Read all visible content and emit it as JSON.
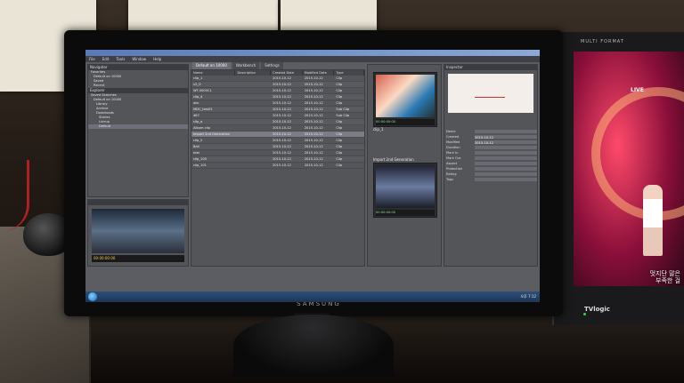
{
  "scene": {
    "monitor_brand": "SAMSUNG",
    "right_monitor_header": "MULTI FORMAT",
    "right_monitor_brand": "TVlogic",
    "right_monitor_show_logo": "LIVE",
    "right_monitor_caption_line1": "멋지단 말은",
    "right_monitor_caption_line2": "부족한 걸"
  },
  "app": {
    "menu": [
      "File",
      "Edit",
      "Tools",
      "Window",
      "Help"
    ],
    "tabs": [
      "Default on 10000",
      "Workbench",
      "Settings"
    ],
    "navigator_title": "Navigator",
    "explorer_title": "Explorer",
    "inspector_title": "Inspector",
    "tree": [
      "Favorites",
      "Default on 10000",
      "Saved",
      "Recent",
      "Explorer",
      "Saved Searches",
      "Default on 10000",
      "Library",
      "Archive",
      "Downloads",
      "Stories",
      "Lineup",
      "Default"
    ],
    "columns": [
      "Name",
      "Description",
      "Created Date",
      "Modified Date",
      "Type"
    ],
    "rows": [
      [
        "clip_1",
        "",
        "2015-10-12",
        "2015-10-12",
        "Clip"
      ],
      [
        "v2_0",
        "",
        "2015-10-12",
        "2015-10-12",
        "Clip"
      ],
      [
        "WT-0000C1",
        "",
        "2015-10-12",
        "2015-10-12",
        "Clip"
      ],
      [
        "clip_4",
        "",
        "2015-10-12",
        "2015-10-12",
        "Clip"
      ],
      [
        "abc",
        "",
        "2015-10-12",
        "2015-10-12",
        "Clip"
      ],
      [
        "MDC_test01",
        "",
        "2015-10-12",
        "2015-10-12",
        "Sub Clip"
      ],
      [
        "487",
        "",
        "2015-10-12",
        "2015-10-12",
        "Sub Clip"
      ],
      [
        "clip_a",
        "",
        "2015-10-12",
        "2015-10-12",
        "Clip"
      ],
      [
        "Album clip",
        "",
        "2015-10-12",
        "2015-10-12",
        "Clip"
      ],
      [
        "Import 2nd Generation",
        "",
        "2015-10-12",
        "2015-10-12",
        "Clip"
      ],
      [
        "clip_5",
        "",
        "2015-10-12",
        "2015-10-12",
        "Clip"
      ],
      [
        "Ball",
        "",
        "2015-10-12",
        "2015-10-12",
        "Clip"
      ],
      [
        "test",
        "",
        "2015-10-12",
        "2015-10-12",
        "Clip"
      ],
      [
        "clip_100",
        "",
        "2015-10-12",
        "2015-10-12",
        "Clip"
      ],
      [
        "clip_101",
        "",
        "2015-10-12",
        "2015-10-12",
        "Clip"
      ]
    ],
    "selected_row_index": 9,
    "thumbs": [
      {
        "label": "00:00:00:00",
        "caption": "clip_1"
      },
      {
        "label": "00:00:00:00",
        "caption": "Import 2nd Generation"
      }
    ],
    "preview_timecode": "00:00:00:00",
    "properties": [
      {
        "k": "Name",
        "v": ""
      },
      {
        "k": "Created",
        "v": "2015-10-12"
      },
      {
        "k": "Modified",
        "v": "2015-10-12"
      },
      {
        "k": "Duration",
        "v": ""
      },
      {
        "k": "Mark In",
        "v": ""
      },
      {
        "k": "Mark Out",
        "v": ""
      },
      {
        "k": "Aspect",
        "v": ""
      },
      {
        "k": "Protection",
        "v": ""
      },
      {
        "k": "Rating",
        "v": ""
      },
      {
        "k": "Tags",
        "v": ""
      }
    ],
    "clock": "오후 7:12"
  }
}
